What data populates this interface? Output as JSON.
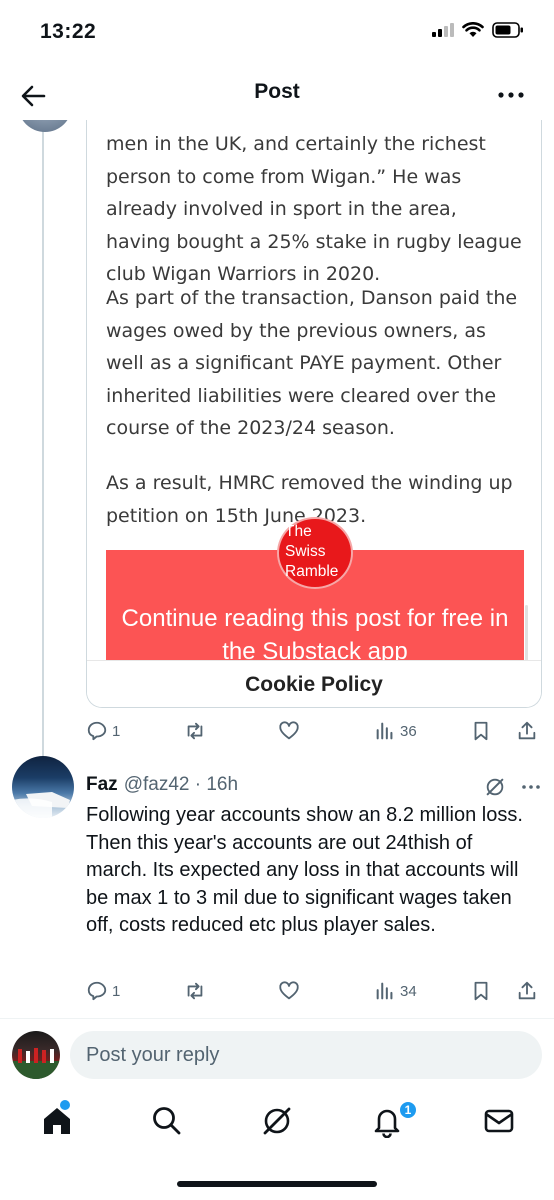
{
  "status_bar": {
    "time": "13:22"
  },
  "header": {
    "title": "Post"
  },
  "card": {
    "p1": "men in the UK, and certainly the richest person to come from Wigan.” He was already involved in sport in the area, having bought a 25% stake in rugby league club Wigan Warriors in 2020.",
    "p2": "As part of the transaction, Danson paid the wages owed by the previous owners, as well as a significant PAYE payment. Other inherited liabilities were cleared over the course of the 2023/24 season.",
    "p3": "As a result, HMRC removed the winding up petition on 15th June 2023.",
    "badge_text": "The Swiss Ramble",
    "cta": "Continue reading this post for free in the Substack app",
    "cookie": "Cookie Policy"
  },
  "main_actions": {
    "replies": "1",
    "views": "36"
  },
  "reply": {
    "name": "Faz",
    "handle": "@faz42 · 16h",
    "text": "Following year accounts show an 8.2 million loss.  Then this year's accounts are out 24thish of march.  Its expected any loss in that accounts will be max 1 to 3 mil due to significant wages taken off, costs reduced etc plus player sales.",
    "replies": "1",
    "views": "34"
  },
  "compose": {
    "placeholder": "Post your reply"
  },
  "nav": {
    "notifications_badge": "1"
  },
  "colors": {
    "accent": "#1d9bf0",
    "cta_red": "#fc5454",
    "badge_red": "#e8181b"
  }
}
